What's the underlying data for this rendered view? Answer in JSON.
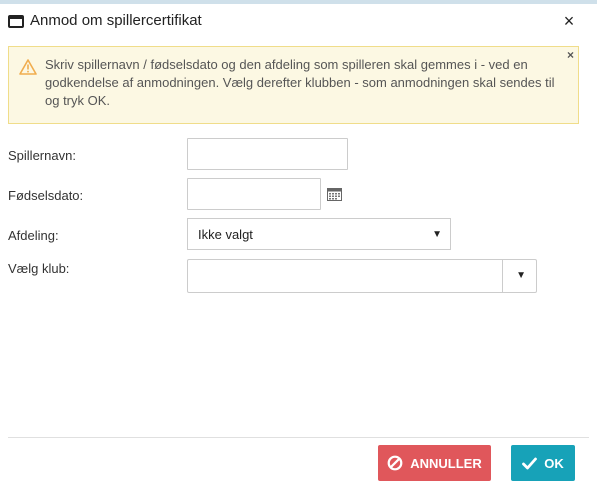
{
  "dialog": {
    "title": "Anmod om spillercertifikat",
    "close_label": "×",
    "icons": {
      "window": "window-icon",
      "close": "close-icon"
    }
  },
  "alert": {
    "text": "Skriv spillernavn / fødselsdato og den afdeling som spilleren skal gemmes i - ved en godkendelse af anmodningen. Vælg derefter klubben - som anmodningen skal sendes til og tryk OK.",
    "close_label": "×",
    "icon": "warning-icon",
    "background": "#fcf8e3",
    "border": "#f0dd8a",
    "icon_color": "#f0ad4e"
  },
  "form": {
    "player_name": {
      "label": "Spillernavn:",
      "value": ""
    },
    "birth_date": {
      "label": "Fødselsdato:",
      "value": "",
      "icon": "calendar-icon"
    },
    "department": {
      "label": "Afdeling:",
      "selected": "Ikke valgt"
    },
    "club": {
      "label": "Vælg klub:",
      "selected": ""
    }
  },
  "buttons": {
    "cancel": {
      "label": "ANNULLER",
      "icon": "cancel-icon",
      "color": "#e0575b"
    },
    "ok": {
      "label": "OK",
      "icon": "check-icon",
      "color": "#17a2b8"
    }
  }
}
